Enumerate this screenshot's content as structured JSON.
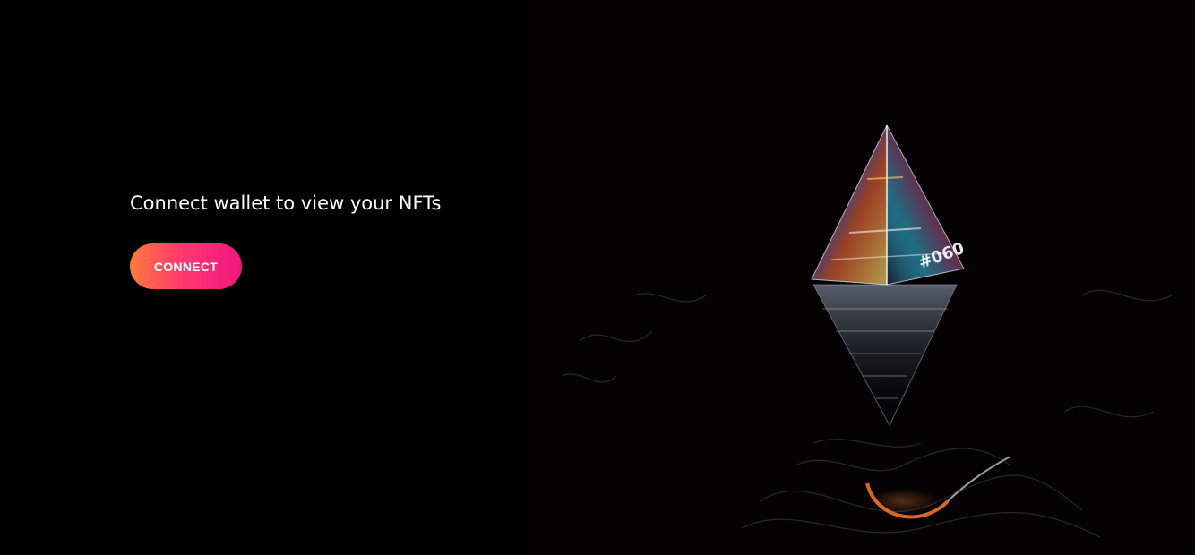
{
  "main": {
    "heading": "Connect wallet to view your NFTs",
    "connect_label": "CONNECT"
  },
  "artwork": {
    "description_icon": "crystal-pyramid-icon",
    "engraved_text": "#060"
  },
  "colors": {
    "background": "#000000",
    "button_gradient_start": "#ff7a3d",
    "button_gradient_end": "#f0177f",
    "text": "#ffffff"
  }
}
